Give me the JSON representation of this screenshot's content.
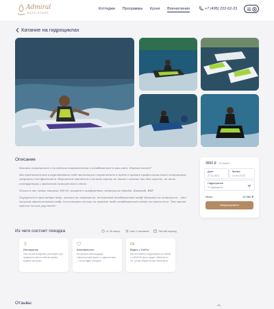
{
  "header": {
    "logo_name": "Admiral",
    "logo_sub": "Bath Stars",
    "nav": [
      {
        "label": "Коттеджи",
        "active": false
      },
      {
        "label": "Программы",
        "active": false
      },
      {
        "label": "Кухня",
        "active": false
      },
      {
        "label": "Впечатления",
        "active": true
      }
    ],
    "phone": "+7 (495) 222-02-23"
  },
  "page": {
    "title": "Катание на гидроциклах"
  },
  "description": {
    "title": "Описание",
    "paragraphs": [
      "Хотите покататься и по водным поверхностям и позабавиться в креслийн. Первый взгляд?",
      "Мы предлагаем вам почувствовать себя настоящим спортсменом и взять в прокат профессиональный спортивный гидроцикл для фристайла. Научиться кататься и делать трюки не такое сложное как это просто, но наши инструкторы с радостью помогут вам в этом.",
      "Только в нас самые мощные 180-65 лошадей в комфортные гидроциклы Yamaha, Kawasaki, BRP.",
      "Окунуться в прохладную воду, летать на гидроцикле, испытывая незабываемый кайф! Катание на гидроцикле – это мощный адреналиновый кайф, для которых только по каждый тебе незабываемый отдых на самом деле. Это время просто нельзя упустить!"
    ]
  },
  "booking": {
    "price": "3650 ₽",
    "price_unit": "/ 15 минут",
    "date_label": "Дата",
    "date_value": "27.11.2021",
    "time_label": "Время",
    "time_value": "14:30-15:15",
    "guests_label": "Гидроциклов",
    "guests_value": "3 Гидроцикла",
    "total_label": "Итого",
    "total_value": "10 950 ₽",
    "button_label": "Забронировать"
  },
  "trip": {
    "title": "Из чего состоит поездка",
    "meta": [
      {
        "icon": "clock-icon",
        "text": "от 15 минут"
      },
      {
        "icon": "people-icon",
        "text": "max 2 человека"
      },
      {
        "icon": "calendar-icon",
        "text": "Летний период"
      }
    ],
    "cards": [
      {
        "icon": "instructor-icon",
        "title": "Инструктаж",
        "text": "Чем лучше владение, расписать про правильно вести себя во время водной прогулки."
      },
      {
        "icon": "shield-icon",
        "title": "Безопасность",
        "text": "На прокате вам выдадут спасательный жилет и гидрокостюм — если будет холодно."
      },
      {
        "icon": "video-icon",
        "title": "Видео с GoPro",
        "text": "Мы отснимем с гидроцикла по тюбинг с собой 60 фото, видео обзором из 4K, ролик сборки не вас бесплатно."
      }
    ]
  },
  "reviews": {
    "title": "Отзывы"
  },
  "colors": {
    "accent": "#b48a63",
    "text": "#2b3350",
    "background": "#f4f4f6"
  }
}
